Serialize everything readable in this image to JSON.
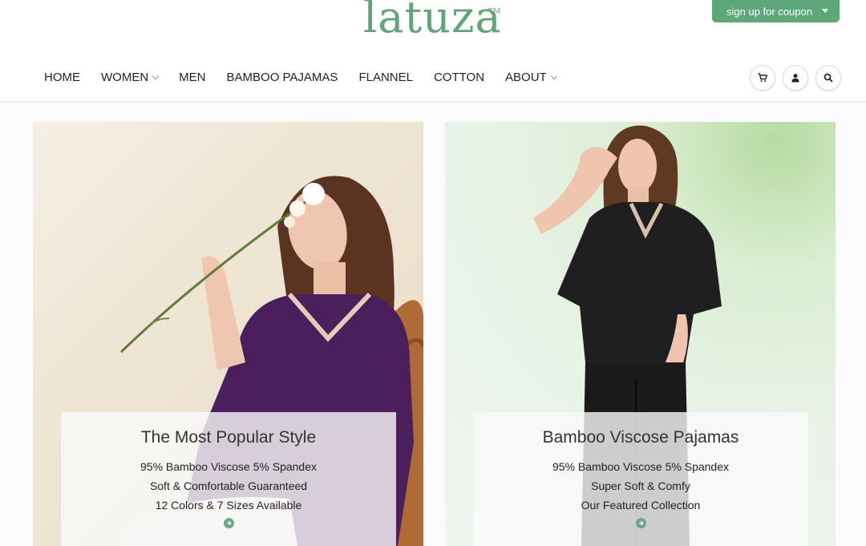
{
  "brand": {
    "name": "latuza",
    "trademark": "TM",
    "color": "#63a37a"
  },
  "coupon": {
    "label": "sign up for coupon"
  },
  "nav": {
    "items": [
      {
        "label": "HOME",
        "has_dropdown": false
      },
      {
        "label": "WOMEN",
        "has_dropdown": true
      },
      {
        "label": "MEN",
        "has_dropdown": false
      },
      {
        "label": "BAMBOO PAJAMAS",
        "has_dropdown": false
      },
      {
        "label": "FLANNEL",
        "has_dropdown": false
      },
      {
        "label": "COTTON",
        "has_dropdown": false
      },
      {
        "label": "ABOUT",
        "has_dropdown": true
      }
    ]
  },
  "header_icons": [
    "cart-icon",
    "user-icon",
    "search-icon"
  ],
  "panels": [
    {
      "title": "The Most Popular Style",
      "lines": [
        "95% Bamboo Viscose 5% Spandex",
        "Soft & Comfortable Guaranteed",
        "12 Colors & 7 Sizes Available"
      ],
      "icon": "arrow-right-circle-icon"
    },
    {
      "title": "Bamboo Viscose Pajamas",
      "lines": [
        "95% Bamboo Viscose 5% Spandex",
        "Super Soft & Comfy",
        "Our Featured Collection"
      ],
      "icon": "arrow-right-circle-icon"
    }
  ],
  "accent_color": "#5ea77b"
}
